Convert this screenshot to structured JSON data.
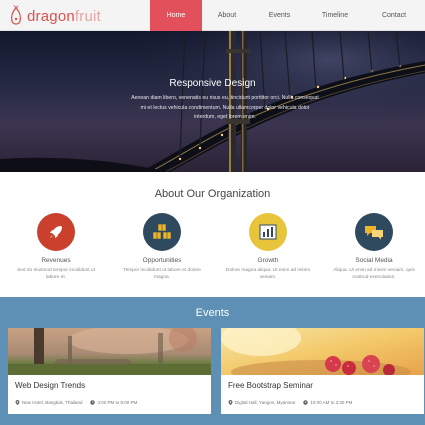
{
  "header": {
    "logo": {
      "part1": "dragon",
      "part2": "fruit",
      "icon": "dragonfruit-logo"
    },
    "nav": [
      {
        "label": "Home",
        "active": true
      },
      {
        "label": "About",
        "active": false
      },
      {
        "label": "Events",
        "active": false
      },
      {
        "label": "Timeline",
        "active": false
      },
      {
        "label": "Contact",
        "active": false
      }
    ]
  },
  "hero": {
    "title": "Responsive Design",
    "text": "Aenean diam libero, venenatis eu risus eu, tincidunt porttitor orci. Nulla consequat mi et lectus vehicula condimentum. Nulla ullamcorper dolor vehicula dolor interdum, eget lorem enim."
  },
  "about": {
    "title": "About Our Organization",
    "features": [
      {
        "title": "Revenues",
        "text": "Sed do eiusmod tempor incididunt ut labore et.",
        "color": "#c9402d",
        "icon": "rocket-icon"
      },
      {
        "title": "Opportunities",
        "text": "Tempor incididunt ut labore et dolore magna.",
        "color": "#2f4a5e",
        "icon": "boxes-icon"
      },
      {
        "title": "Growth",
        "text": "Dolore magna aliqua. Ut enim ad minim veniam.",
        "color": "#e8c43a",
        "icon": "chart-icon"
      },
      {
        "title": "Social Media",
        "text": "Aliqua. Ut enim ad minim veniam, quis nostrud exercitation.",
        "color": "#2f4a5e",
        "icon": "chat-icon"
      }
    ]
  },
  "events": {
    "title": "Events",
    "cards": [
      {
        "title": "Web Design Trends",
        "location": "New Hotel, Bangkok, Thailand",
        "time": "4:00 PM to 8:00 PM"
      },
      {
        "title": "Free Bootstrap Seminar",
        "location": "Digital Hall, Yangon, Myanmar",
        "time": "10:00 AM to 3:30 PM"
      }
    ]
  },
  "colors": {
    "accent": "#e2505c",
    "events_bg": "#5e8fb4"
  }
}
